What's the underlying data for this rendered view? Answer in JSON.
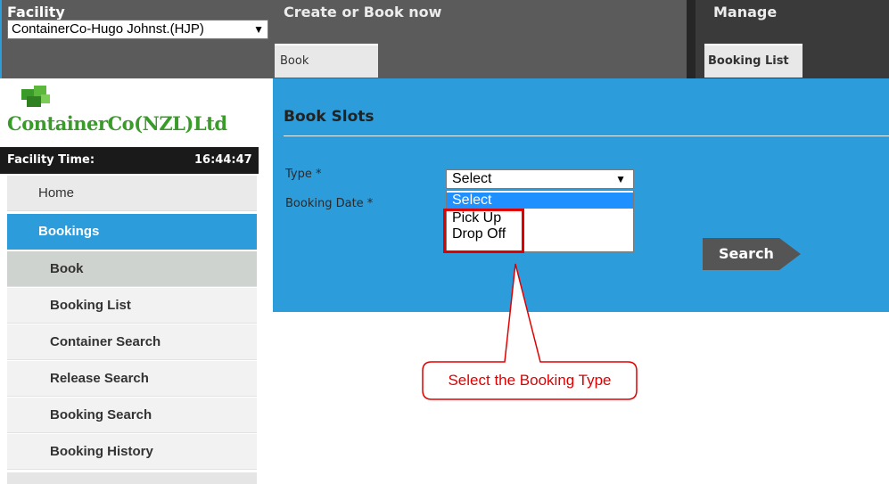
{
  "header": {
    "facility_label": "Facility",
    "facility_value": "ContainerCo-Hugo Johnst.(HJP)",
    "create_label": "Create or Book now",
    "book_tab": "Book",
    "manage_label": "Manage",
    "booking_list_tab": "Booking List"
  },
  "sidebar": {
    "logo_text": "ContainerCo(NZL)Ltd",
    "facility_time_label": "Facility Time:",
    "facility_time_value": "16:44:47",
    "items": [
      {
        "label": "Home"
      },
      {
        "label": "Bookings"
      },
      {
        "label": "Book"
      },
      {
        "label": "Booking List"
      },
      {
        "label": "Container Search"
      },
      {
        "label": "Release Search"
      },
      {
        "label": "Booking Search"
      },
      {
        "label": "Booking History"
      }
    ]
  },
  "main": {
    "title": "Book Slots",
    "type_label": "Type *",
    "date_label": "Booking Date *",
    "type_select_value": "Select",
    "type_options": [
      "Select",
      "Pick Up",
      "Drop Off"
    ],
    "search_button": "Search"
  },
  "annotation": {
    "callout": "Select the Booking Type"
  },
  "colors": {
    "accent_blue": "#2d9cdb",
    "header_grey": "#5b5b5b",
    "annotation_red": "#e00000",
    "logo_green": "#3a9a2a"
  }
}
